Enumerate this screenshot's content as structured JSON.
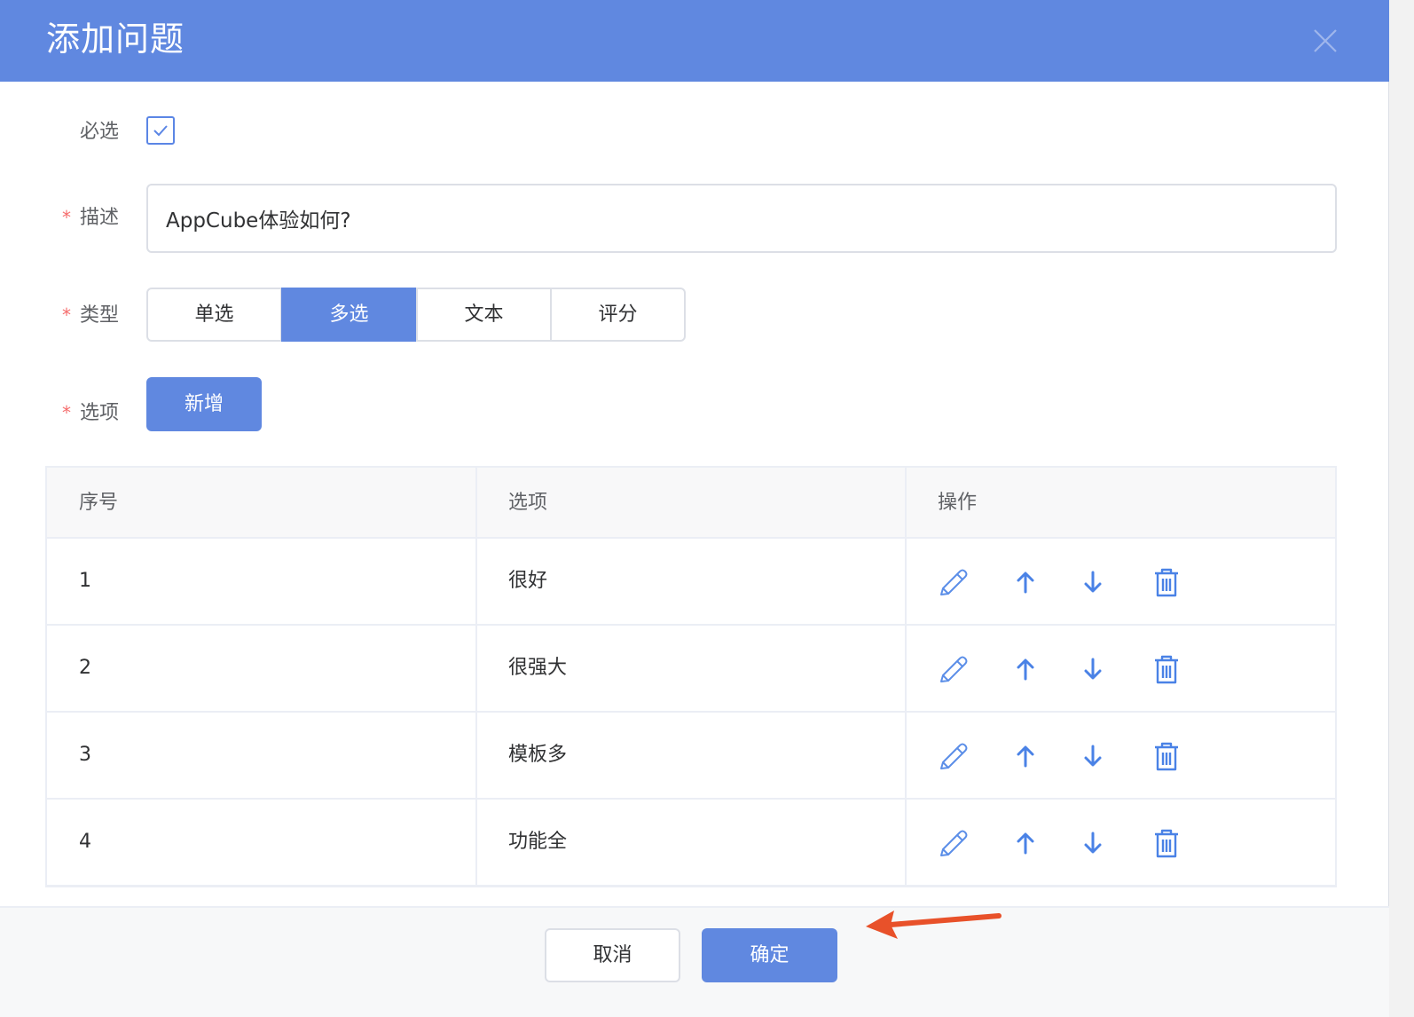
{
  "dialog": {
    "title": "添加问题",
    "close_icon": "close-icon"
  },
  "form": {
    "required_label": "必选",
    "required_checked": true,
    "description_label": "描述",
    "description_value": "AppCube体验如何?",
    "type_label": "类型",
    "type_options": [
      "单选",
      "多选",
      "文本",
      "评分"
    ],
    "type_selected": "多选",
    "options_label": "选项",
    "add_button": "新增",
    "required_marker": "*"
  },
  "table": {
    "columns": [
      "序号",
      "选项",
      "操作"
    ],
    "rows": [
      {
        "index": "1",
        "option": "很好"
      },
      {
        "index": "2",
        "option": "很强大"
      },
      {
        "index": "3",
        "option": "模板多"
      },
      {
        "index": "4",
        "option": "功能全"
      }
    ],
    "actions": [
      "edit-icon",
      "arrow-up-icon",
      "arrow-down-icon",
      "trash-icon"
    ]
  },
  "footer": {
    "cancel_label": "取消",
    "confirm_label": "确定"
  },
  "colors": {
    "primary": "#6088e0",
    "required": "#f56c6c",
    "annotation_arrow": "#e8512a"
  }
}
